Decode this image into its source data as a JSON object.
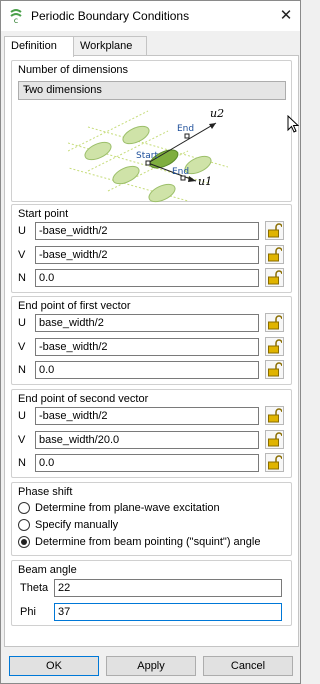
{
  "window": {
    "title": "Periodic Boundary Conditions",
    "close_glyph": "✕"
  },
  "tabs": [
    {
      "label": "Definition"
    },
    {
      "label": "Workplane"
    }
  ],
  "dimensions": {
    "group_title": "Number of dimensions",
    "selected": "Two dimensions",
    "diagram_labels": {
      "u2": "u2",
      "u1": "u1",
      "start": "Start",
      "end_top": "End",
      "end_bottom": "End"
    }
  },
  "start_point": {
    "title": "Start point",
    "u": {
      "label": "U",
      "value": "-base_width/2"
    },
    "v": {
      "label": "V",
      "value": "-base_width/2"
    },
    "n": {
      "label": "N",
      "value": "0.0"
    }
  },
  "first_vector": {
    "title": "End point of first vector",
    "u": {
      "label": "U",
      "value": "base_width/2"
    },
    "v": {
      "label": "V",
      "value": "-base_width/2"
    },
    "n": {
      "label": "N",
      "value": "0.0"
    }
  },
  "second_vector": {
    "title": "End point of second vector",
    "u": {
      "label": "U",
      "value": "-base_width/2"
    },
    "v": {
      "label": "V",
      "value": "base_width/20.0"
    },
    "n": {
      "label": "N",
      "value": "0.0"
    }
  },
  "phase_shift": {
    "title": "Phase shift",
    "options": [
      {
        "label": "Determine from plane-wave excitation",
        "checked": false
      },
      {
        "label": "Specify manually",
        "checked": false
      },
      {
        "label": "Determine from beam pointing (\"squint\") angle",
        "checked": true
      }
    ]
  },
  "beam_angle": {
    "title": "Beam angle",
    "theta": {
      "label": "Theta",
      "value": "22"
    },
    "phi": {
      "label": "Phi",
      "value": "37"
    }
  },
  "buttons": {
    "ok": "OK",
    "apply": "Apply",
    "cancel": "Cancel"
  },
  "colors": {
    "accent": "#0078d7",
    "lock_gold": "#c8a000",
    "ellipse_green": "#b5d48a",
    "ellipse_selected": "#7fae3f"
  }
}
